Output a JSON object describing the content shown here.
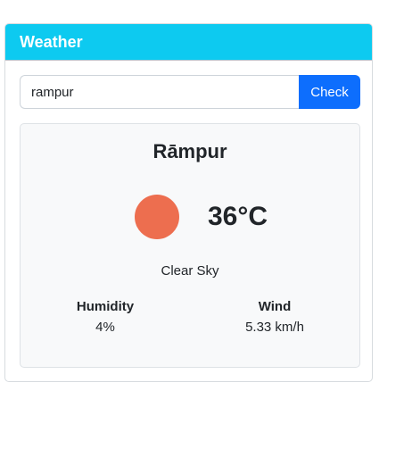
{
  "header": {
    "title": "Weather"
  },
  "search": {
    "value": "rampur",
    "placeholder": "",
    "button_label": "Check"
  },
  "result": {
    "city": "Rāmpur",
    "icon": "sun-icon",
    "icon_color": "#ed6e4f",
    "temperature": "36°C",
    "condition": "Clear Sky",
    "humidity_label": "Humidity",
    "humidity_value": "4%",
    "wind_label": "Wind",
    "wind_value": "5.33 km/h"
  },
  "colors": {
    "header_bg": "#0dcaf0",
    "button_bg": "#0d6efd",
    "panel_bg": "#f8f9fa"
  }
}
